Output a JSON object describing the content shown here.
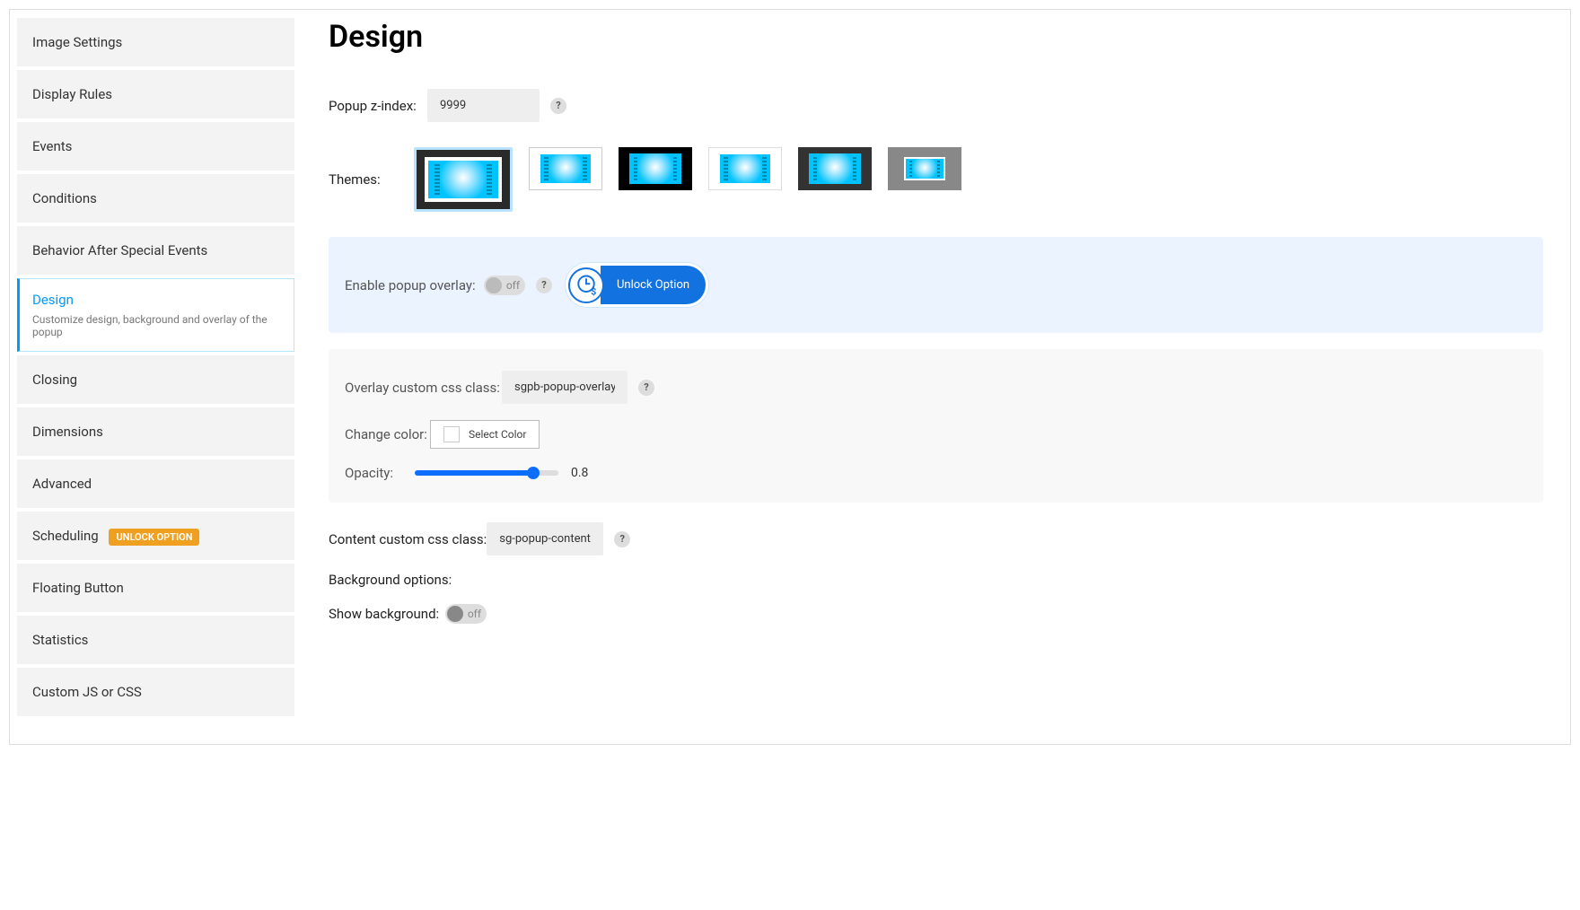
{
  "sidebar": {
    "items": [
      {
        "label": "Image Settings"
      },
      {
        "label": "Display Rules"
      },
      {
        "label": "Events"
      },
      {
        "label": "Conditions"
      },
      {
        "label": "Behavior After Special Events"
      },
      {
        "label": "Design",
        "desc": "Customize design, background and overlay of the popup",
        "active": true
      },
      {
        "label": "Closing"
      },
      {
        "label": "Dimensions"
      },
      {
        "label": "Advanced"
      },
      {
        "label": "Scheduling",
        "badge": "UNLOCK OPTION"
      },
      {
        "label": "Floating Button"
      },
      {
        "label": "Statistics"
      },
      {
        "label": "Custom JS or CSS"
      }
    ]
  },
  "main": {
    "title": "Design",
    "zindex": {
      "label": "Popup z-index:",
      "value": "9999"
    },
    "themes_label": "Themes:",
    "overlay": {
      "enable_label": "Enable popup overlay:",
      "toggle_text": "off",
      "unlock_text": "Unlock Option",
      "custom_class_label": "Overlay custom css class:",
      "custom_class_value": "sgpb-popup-overlay",
      "color_label": "Change color:",
      "color_btn": "Select Color",
      "opacity_label": "Opacity:",
      "opacity_value": "0.8"
    },
    "content_class": {
      "label": "Content custom css class:",
      "value": "sg-popup-content"
    },
    "bg_options_label": "Background options:",
    "show_bg": {
      "label": "Show background:",
      "toggle_text": "off"
    }
  }
}
